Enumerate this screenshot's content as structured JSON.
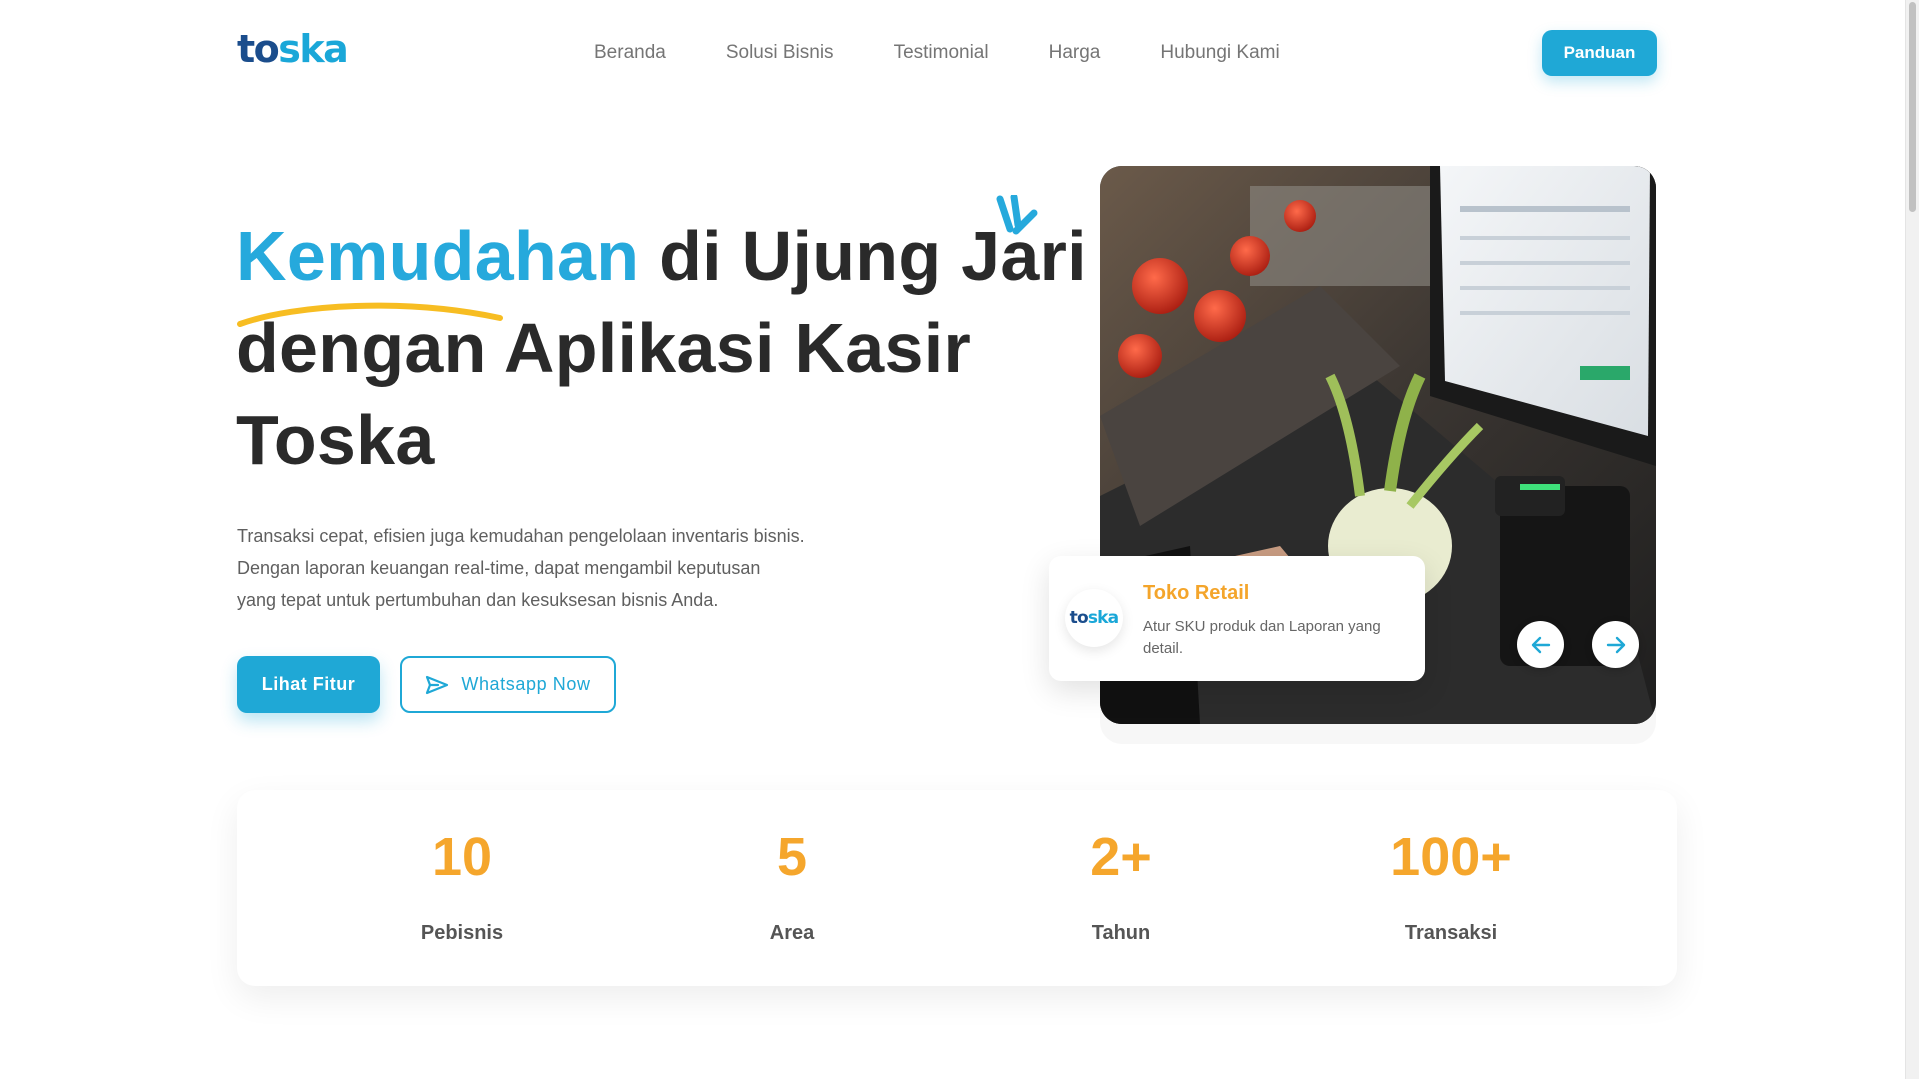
{
  "brand": {
    "logo_part1": "to",
    "logo_part2": "ska"
  },
  "nav": {
    "items": [
      "Beranda",
      "Solusi Bisnis",
      "Testimonial",
      "Harga",
      "Hubungi Kami"
    ],
    "cta_label": "Panduan"
  },
  "hero": {
    "headline_accent": "Kemudahan",
    "headline_line1_rest": " di Ujung Jari",
    "headline_line2": "dengan Aplikasi Kasir",
    "headline_line3": "Toska",
    "description_lines": [
      "Transaksi cepat, efisien juga kemudahan pengelolaan inventaris bisnis.",
      "Dengan laporan keuangan real-time, dapat mengambil keputusan",
      "yang tepat untuk pertumbuhan dan kesuksesan bisnis Anda."
    ],
    "primary_button": "Lihat Fitur",
    "secondary_button": "Whatsapp Now"
  },
  "slider": {
    "card_title": "Toko Retail",
    "card_text": "Atur SKU produk dan Laporan yang detail.",
    "card_logo_part1": "to",
    "card_logo_part2": "ska",
    "prev_icon": "arrow-left-icon",
    "next_icon": "arrow-right-icon"
  },
  "stats": [
    {
      "value": "10",
      "label": "Pebisnis"
    },
    {
      "value": "5",
      "label": "Area"
    },
    {
      "value": "2+",
      "label": "Tahun"
    },
    {
      "value": "100+",
      "label": "Transaksi"
    }
  ],
  "colors": {
    "primary": "#1fa8d6",
    "accent_orange": "#f5a62c",
    "headline_dark": "#2a2a2a",
    "logo_dark": "#1b4d8c"
  }
}
